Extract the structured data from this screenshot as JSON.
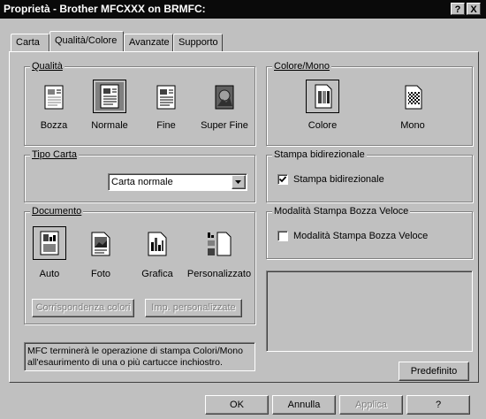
{
  "window": {
    "title": "Proprietà - Brother MFCXXX on BRMFC:",
    "help_btn": "?",
    "close_btn": "X"
  },
  "tabs": [
    "Carta",
    "Qualità/Colore",
    "Avanzate",
    "Supporto"
  ],
  "quality": {
    "title": "Qualità",
    "options": [
      "Bozza",
      "Normale",
      "Fine",
      "Super Fine"
    ],
    "selected": "Normale"
  },
  "color_mono": {
    "title": "Colore/Mono",
    "options": [
      "Colore",
      "Mono"
    ],
    "selected": "Colore"
  },
  "paper_type": {
    "title": "Tipo Carta",
    "value": "Carta normale"
  },
  "bidirectional": {
    "title": "Stampa bidirezionale",
    "checkbox_label": "Stampa bidirezionale",
    "checked": true
  },
  "document": {
    "title": "Documento",
    "options": [
      "Auto",
      "Foto",
      "Grafica",
      "Personalizzato"
    ],
    "selected": "Auto",
    "match_colors_btn": "Corrispondenza colori",
    "custom_settings_btn": "Imp. personalizzate"
  },
  "fast_draft": {
    "title": "Modalità Stampa Bozza Veloce",
    "checkbox_label": "Modalità Stampa Bozza Veloce",
    "checked": false
  },
  "info_text": "MFC terminerà le operazione di stampa Colori/Mono all'esaurimento di una o più cartucce inchiostro.",
  "buttons": {
    "default": "Predefinito",
    "ok": "OK",
    "cancel": "Annulla",
    "apply": "Applica",
    "help": "?"
  }
}
